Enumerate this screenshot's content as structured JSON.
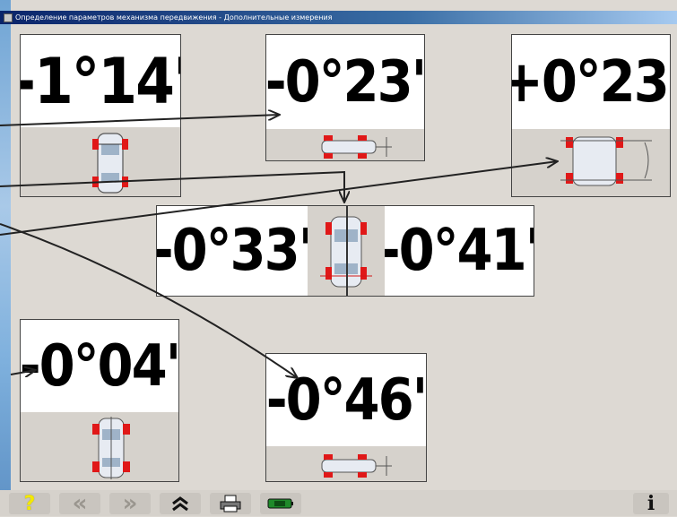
{
  "window": {
    "title": "Определение параметров механизма передвижения - Дополнительные измерения"
  },
  "measurements": {
    "m1": "-1°14'",
    "m2": "-0°23'",
    "m3": "+0°23'",
    "m4_left": "-0°33'",
    "m4_right": "-0°41'",
    "m5": "-0°04'",
    "m6": "-0°46'"
  },
  "toolbar": {
    "help_glyph": "?",
    "back_glyph": "«",
    "forward_glyph": "»",
    "up_glyph": "⌃",
    "info_glyph": "i"
  },
  "colors": {
    "wheel_red": "#e01818",
    "help_yellow": "#f3e800"
  }
}
